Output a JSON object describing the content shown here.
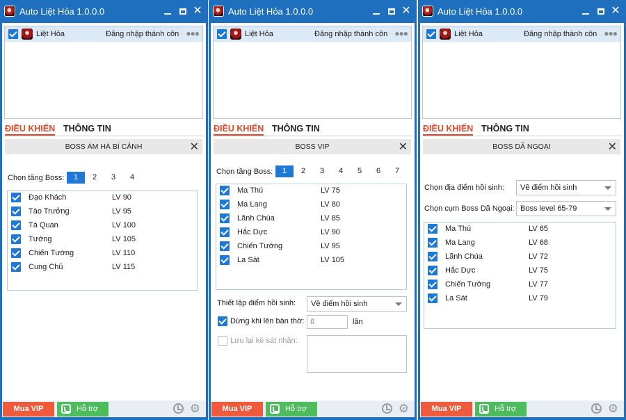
{
  "windows": [
    {
      "title": "Auto Liệt Hỏa 1.0.0.0",
      "account": {
        "name": "Liệt Hỏa",
        "status": "Đăng nhập thành côn"
      },
      "tabs": {
        "control": "ĐIỀU KHIỂN",
        "info": "THÔNG TIN"
      },
      "section_title": "BOSS ÁM HÀ BÍ CẢNH",
      "floor_label": "Chọn tầng Boss:",
      "floors": [
        "1",
        "2",
        "3",
        "4"
      ],
      "bosses": [
        {
          "name": "Đạo Khách",
          "lv": "LV 90"
        },
        {
          "name": "Tào Trưởng",
          "lv": "LV 95"
        },
        {
          "name": "Tá Quan",
          "lv": "LV 100"
        },
        {
          "name": "Tướng",
          "lv": "LV 105"
        },
        {
          "name": "Chiến Tướng",
          "lv": "LV 110"
        },
        {
          "name": "Cung Chủ",
          "lv": "LV 115"
        }
      ],
      "footer": {
        "vip": "Mua VIP",
        "support": "Hỗ trợ"
      }
    },
    {
      "title": "Auto Liệt Hỏa 1.0.0.0",
      "account": {
        "name": "Liệt Hỏa",
        "status": "Đăng nhập thành côn"
      },
      "tabs": {
        "control": "ĐIỀU KHIỂN",
        "info": "THÔNG TIN"
      },
      "section_title": "BOSS VIP",
      "floor_label": "Chọn tầng Boss:",
      "floors": [
        "1",
        "2",
        "3",
        "4",
        "5",
        "6",
        "7"
      ],
      "bosses": [
        {
          "name": "Ma Thú",
          "lv": "LV 75"
        },
        {
          "name": "Ma Lang",
          "lv": "LV 80"
        },
        {
          "name": "Lãnh Chúa",
          "lv": "LV 85"
        },
        {
          "name": "Hắc Dực",
          "lv": "LV 90"
        },
        {
          "name": "Chiến Tướng",
          "lv": "LV 95"
        },
        {
          "name": "La Sát",
          "lv": "LV 105"
        }
      ],
      "respawn_label": "Thiết lập điểm hồi sinh:",
      "respawn_value": "Về điểm hồi sinh",
      "stop_label": "Dừng khi lên bàn thờ:",
      "stop_value": "6",
      "stop_unit": "lần",
      "save_killer_label": "Lưu lại kẻ sát nhân:",
      "footer": {
        "vip": "Mua VIP",
        "support": "Hỗ trợ"
      }
    },
    {
      "title": "Auto Liệt Hỏa 1.0.0.0",
      "account": {
        "name": "Liệt Hỏa",
        "status": "Đăng nhập thành côn"
      },
      "tabs": {
        "control": "ĐIỀU KHIỂN",
        "info": "THÔNG TIN"
      },
      "section_title": "BOSS DÃ NGOẠI",
      "respawn_label": "Chọn địa điểm hồi sinh:",
      "respawn_value": "Về điểm hồi sinh",
      "cluster_label": "Chọn cụm Boss Dã Ngoại:",
      "cluster_value": "Boss level 65-79",
      "bosses": [
        {
          "name": "Ma Thú",
          "lv": "LV 65"
        },
        {
          "name": "Ma Lang",
          "lv": "LV 68"
        },
        {
          "name": "Lãnh Chúa",
          "lv": "LV 72"
        },
        {
          "name": "Hắc Dực",
          "lv": "LV 75"
        },
        {
          "name": "Chiến Tướng",
          "lv": "LV 77"
        },
        {
          "name": "La Sát",
          "lv": "LV 79"
        }
      ],
      "footer": {
        "vip": "Mua VIP",
        "support": "Hỗ trợ"
      }
    }
  ]
}
